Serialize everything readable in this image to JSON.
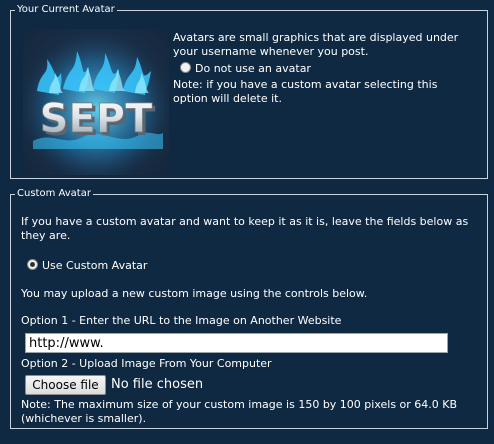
{
  "current_avatar": {
    "legend": "Your Current Avatar",
    "avatar_alt_text": "SEPT",
    "description": "Avatars are small graphics that are displayed under your username whenever you post.",
    "no_avatar_label": "Do not use an avatar",
    "note": "Note: if you have a custom avatar selecting this option will delete it."
  },
  "custom_avatar": {
    "legend": "Custom Avatar",
    "intro": "If you have a custom avatar and want to keep it as it is, leave the fields below as they are.",
    "use_custom_label": "Use Custom Avatar",
    "upload_hint": "You may upload a new custom image using the controls below.",
    "option1_label": "Option 1 - Enter the URL to the Image on Another Website",
    "url_value": "http://www.",
    "option2_label": "Option 2 - Upload Image From Your Computer",
    "choose_file_label": "Choose file",
    "file_status": "No file chosen",
    "size_note": "Note: The maximum size of your custom image is 150 by 100 pixels or 64.0 KB (whichever is smaller)."
  },
  "colors": {
    "background": "#0f2942",
    "border": "#c9d3dd",
    "text": "#ffffff",
    "flame": "#39c8ff"
  }
}
